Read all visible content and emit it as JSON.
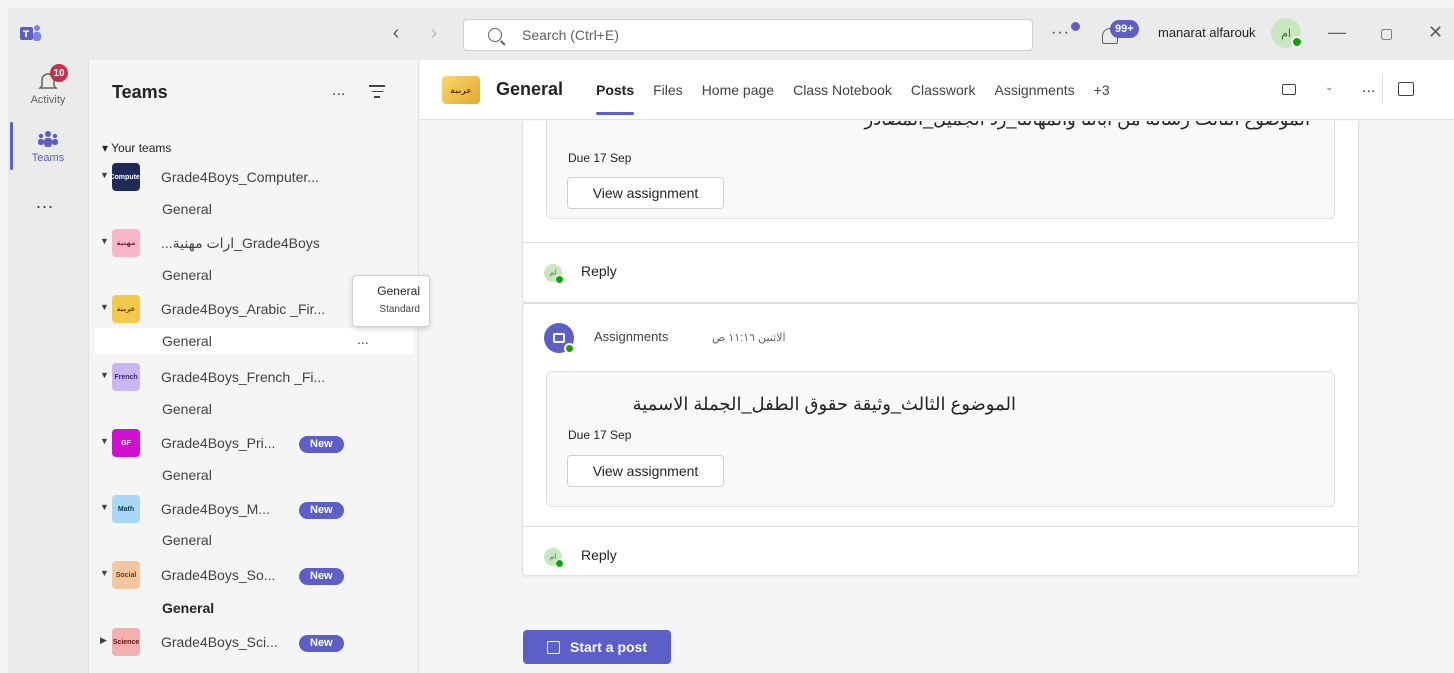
{
  "titlebar": {
    "search_placeholder": "Search (Ctrl+E)",
    "notifications_badge": "99+",
    "user_name": "manarat alfarouk",
    "user_initials": "ام"
  },
  "rail": {
    "activity_label": "Activity",
    "activity_badge": "10",
    "teams_label": "Teams",
    "more_label": "..."
  },
  "teams_panel": {
    "title": "Teams",
    "more": "...",
    "section_label": "Your teams",
    "teams": [
      {
        "name": "Grade4Boys_Computer...",
        "tile_text": "Computer",
        "tile_color": "#1e2a5a",
        "channel": "General",
        "is_new": false
      },
      {
        "name": "...ارات مهنية_Grade4Boys",
        "tile_text": "مهنية",
        "tile_color": "#f7b6c8",
        "channel": "General",
        "is_new": false
      },
      {
        "name": "Grade4Boys_Arabic _Fir...",
        "tile_text": "عربية",
        "tile_color": "#f2c94c",
        "channel": "General",
        "is_new": false
      },
      {
        "name": "Grade4Boys_French _Fi...",
        "tile_text": "French",
        "tile_color": "#c9b6f2",
        "channel": "General",
        "is_new": false
      },
      {
        "name": "Grade4Boys_Pri...",
        "tile_text": "GF",
        "tile_color": "#d10fd1",
        "channel": "General",
        "is_new": true
      },
      {
        "name": "Grade4Boys_M...",
        "tile_text": "Math",
        "tile_color": "#a9d8f5",
        "channel": "General",
        "is_new": true
      },
      {
        "name": "Grade4Boys_So...",
        "tile_text": "Social",
        "tile_color": "#f5c6a0",
        "channel": "General",
        "is_new": true
      },
      {
        "name": "Grade4Boys_Sci...",
        "tile_text": "Science",
        "tile_color": "#f2b0b0",
        "channel": "",
        "is_new": true
      }
    ],
    "new_badge": "New",
    "channel_more": "...",
    "tooltip": {
      "title": "General",
      "subtitle": "Standard"
    }
  },
  "channel_header": {
    "tile_text": "عربية",
    "name": "General",
    "tabs": [
      "Posts",
      "Files",
      "Home page",
      "Class Notebook",
      "Classwork",
      "Assignments",
      "+3"
    ],
    "active_tab": "Posts",
    "more": "..."
  },
  "posts": [
    {
      "assignment_title": "الموضوع الثالث رسالة من أبائنا والمهاتنا_رد الجميل_المصادر",
      "due": "Due 17 Sep",
      "button": "View assignment",
      "reply": "Reply"
    },
    {
      "sender": "Assignments",
      "time": "الاثنين ١١:١٦ ص",
      "assignment_title": "الموضوع الثالث_وثيقة حقوق الطفل_الجملة الاسمية",
      "due": "Due 17 Sep",
      "button": "View assignment",
      "reply": "Reply"
    }
  ],
  "reply_initials": "ام",
  "start_post": "Start a post",
  "colors": {
    "accent": "#5b5fc7",
    "presence": "#13a10e",
    "alert": "#c4314b"
  }
}
